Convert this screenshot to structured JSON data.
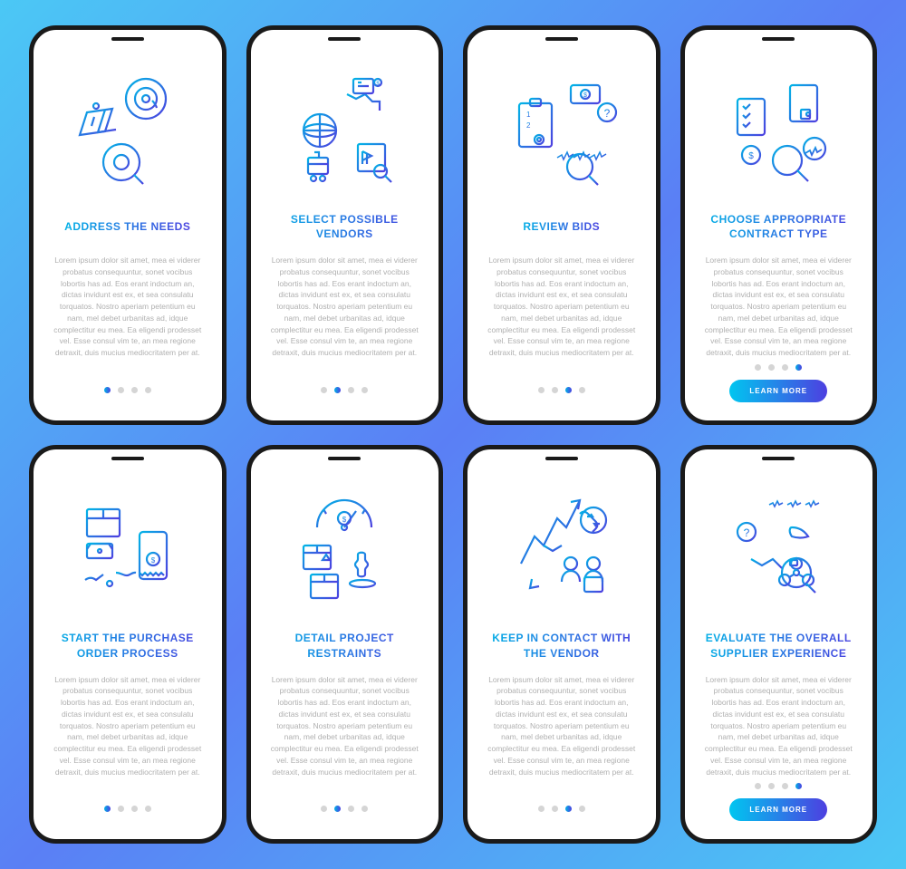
{
  "lorem": "Lorem ipsum dolor sit amet, mea ei viderer probatus consequuntur, sonet vocibus lobortis has ad. Eos erant indoctum an, dictas invidunt est ex, et sea consulatu torquatos. Nostro aperiam petentium eu nam, mel debet urbanitas ad, idque complectitur eu mea. Ea eligendi prodesset vel. Esse consul vim te, an mea regione detraxit, duis mucius mediocritatem per at.",
  "learn_label": "LEARN MORE",
  "cards": [
    {
      "title": "ADDRESS THE NEEDS",
      "active_dot": 0,
      "has_button": false
    },
    {
      "title": "SELECT POSSIBLE VENDORS",
      "active_dot": 1,
      "has_button": false
    },
    {
      "title": "REVIEW BIDS",
      "active_dot": 2,
      "has_button": false
    },
    {
      "title": "CHOOSE APPROPRIATE CONTRACT TYPE",
      "active_dot": 3,
      "has_button": true
    },
    {
      "title": "START THE PURCHASE ORDER PROCESS",
      "active_dot": 0,
      "has_button": false
    },
    {
      "title": "DETAIL PROJECT RESTRAINTS",
      "active_dot": 1,
      "has_button": false
    },
    {
      "title": "KEEP IN CONTACT WITH THE VENDOR",
      "active_dot": 2,
      "has_button": false
    },
    {
      "title": "EVALUATE THE OVERALL SUPPLIER EXPERIENCE",
      "active_dot": 3,
      "has_button": true
    }
  ]
}
